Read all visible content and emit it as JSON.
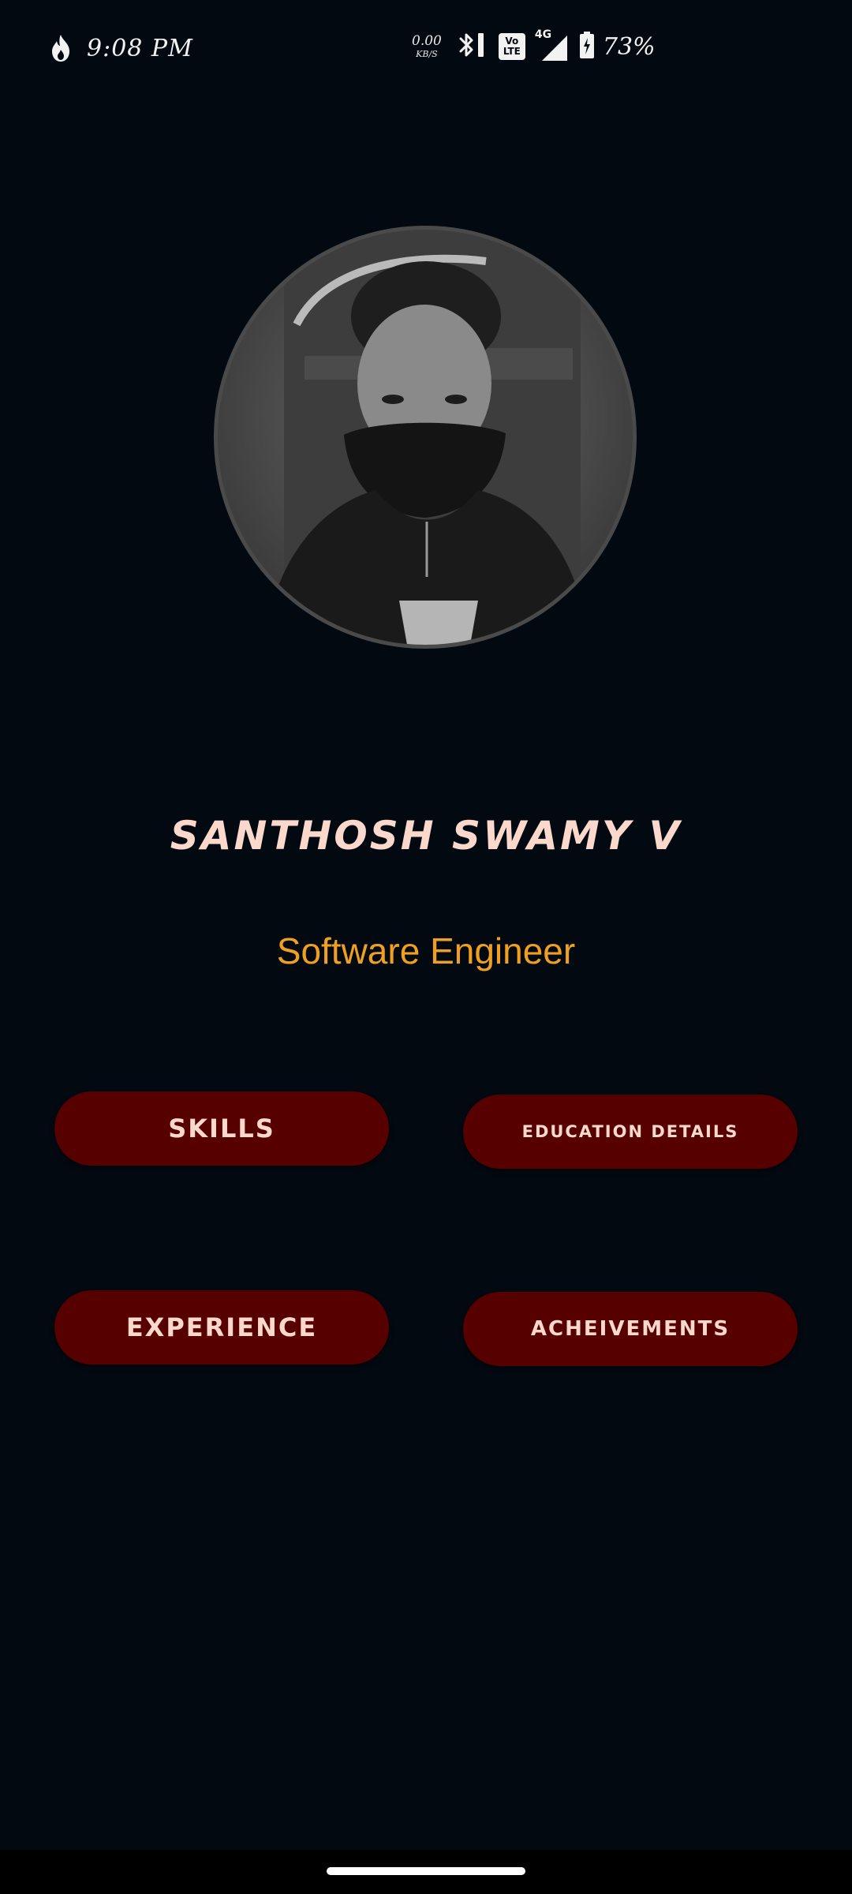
{
  "status_bar": {
    "time": "9:08 PM",
    "net_speed_value": "0.00",
    "net_speed_unit": "KB/S",
    "volte_top": "Vo",
    "volte_bottom": "LTE",
    "network_type": "4G",
    "battery": "73%",
    "icons": [
      "flame-icon",
      "bluetooth-icon",
      "volte-icon",
      "signal-icon",
      "battery-charging-icon"
    ]
  },
  "profile": {
    "name": "SANTHOSH SWAMY V",
    "role": "Software Engineer",
    "avatar_icon": "profile-photo"
  },
  "buttons": {
    "skills": "SKILLS",
    "education": "EDUCATION DETAILS",
    "experience": "EXPERIENCE",
    "achievements": "ACHEIVEMENTS"
  },
  "colors": {
    "background": "#030911",
    "button_bg": "#560000",
    "button_text": "#fbd8cc",
    "name_text": "#fbd8cc",
    "role_text": "#f0a021"
  }
}
